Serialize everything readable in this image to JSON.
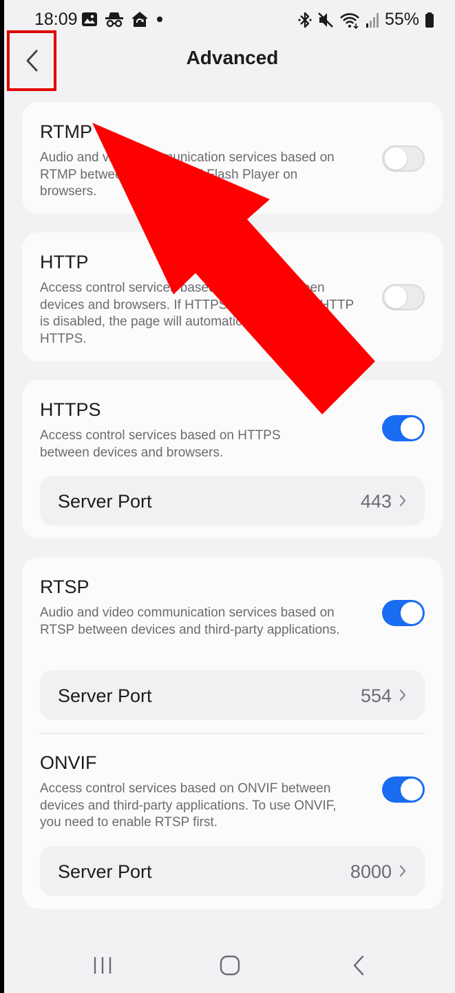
{
  "status_bar": {
    "time": "18:09",
    "battery": "55%",
    "left_icons": [
      "gallery-icon",
      "incognito-icon",
      "home-sync-icon",
      "dot-icon"
    ],
    "right_icons": [
      "bluetooth-icon",
      "mute-icon",
      "wifi-icon",
      "signal-icon",
      "battery-icon"
    ]
  },
  "header": {
    "title": "Advanced",
    "back_icon": "chevron-left-icon"
  },
  "sections": {
    "rtmp": {
      "title": "RTMP",
      "description": "Audio and video communication services based on RTMP between devices and Flash Player on browsers.",
      "enabled": false
    },
    "http": {
      "title": "HTTP",
      "description": "Access control services based on HTTP between devices and browsers. If HTTPS is enabled and HTTP is disabled, the page will automatically jump to HTTPS.",
      "enabled": false
    },
    "https": {
      "title": "HTTPS",
      "description": "Access control services based on HTTPS between devices and browsers.",
      "enabled": true,
      "port_label": "Server Port",
      "port_value": "443"
    },
    "rtsp": {
      "title": "RTSP",
      "description": "Audio and video communication services based on RTSP between devices and third-party applications.",
      "enabled": true,
      "port_label": "Server Port",
      "port_value": "554"
    },
    "onvif": {
      "title": "ONVIF",
      "description": "Access control services based on ONVIF between devices and third-party applications. To use ONVIF, you need to enable RTSP first.",
      "enabled": true,
      "port_label": "Server Port",
      "port_value": "8000"
    }
  },
  "colors": {
    "accent": "#1a6cf0",
    "annotation": "#ff0000",
    "background": "#f2f2f4",
    "card": "#fbfbfc"
  },
  "nav_bar": {
    "icons": [
      "recents-icon",
      "home-icon",
      "back-icon"
    ]
  }
}
